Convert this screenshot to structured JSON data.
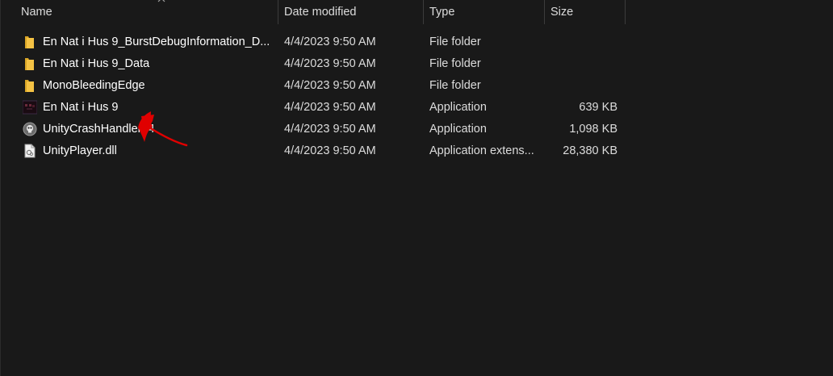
{
  "columns": {
    "name": "Name",
    "date": "Date modified",
    "type": "Type",
    "size": "Size"
  },
  "files": [
    {
      "name": "En Nat i Hus 9_BurstDebugInformation_D...",
      "date": "4/4/2023 9:50 AM",
      "type": "File folder",
      "size": "",
      "icon": "folder-icon"
    },
    {
      "name": "En Nat i Hus 9_Data",
      "date": "4/4/2023 9:50 AM",
      "type": "File folder",
      "size": "",
      "icon": "folder-icon"
    },
    {
      "name": "MonoBleedingEdge",
      "date": "4/4/2023 9:50 AM",
      "type": "File folder",
      "size": "",
      "icon": "folder-icon"
    },
    {
      "name": "En Nat i Hus 9",
      "date": "4/4/2023 9:50 AM",
      "type": "Application",
      "size": "639 KB",
      "icon": "game-app-icon"
    },
    {
      "name": "UnityCrashHandler64",
      "date": "4/4/2023 9:50 AM",
      "type": "Application",
      "size": "1,098 KB",
      "icon": "unity-crash-handler-icon"
    },
    {
      "name": "UnityPlayer.dll",
      "date": "4/4/2023 9:50 AM",
      "type": "Application extens...",
      "size": "28,380 KB",
      "icon": "dll-file-icon"
    }
  ],
  "colors": {
    "background": "#191919",
    "folder": "#f4c244",
    "annotation": "#e00000"
  }
}
